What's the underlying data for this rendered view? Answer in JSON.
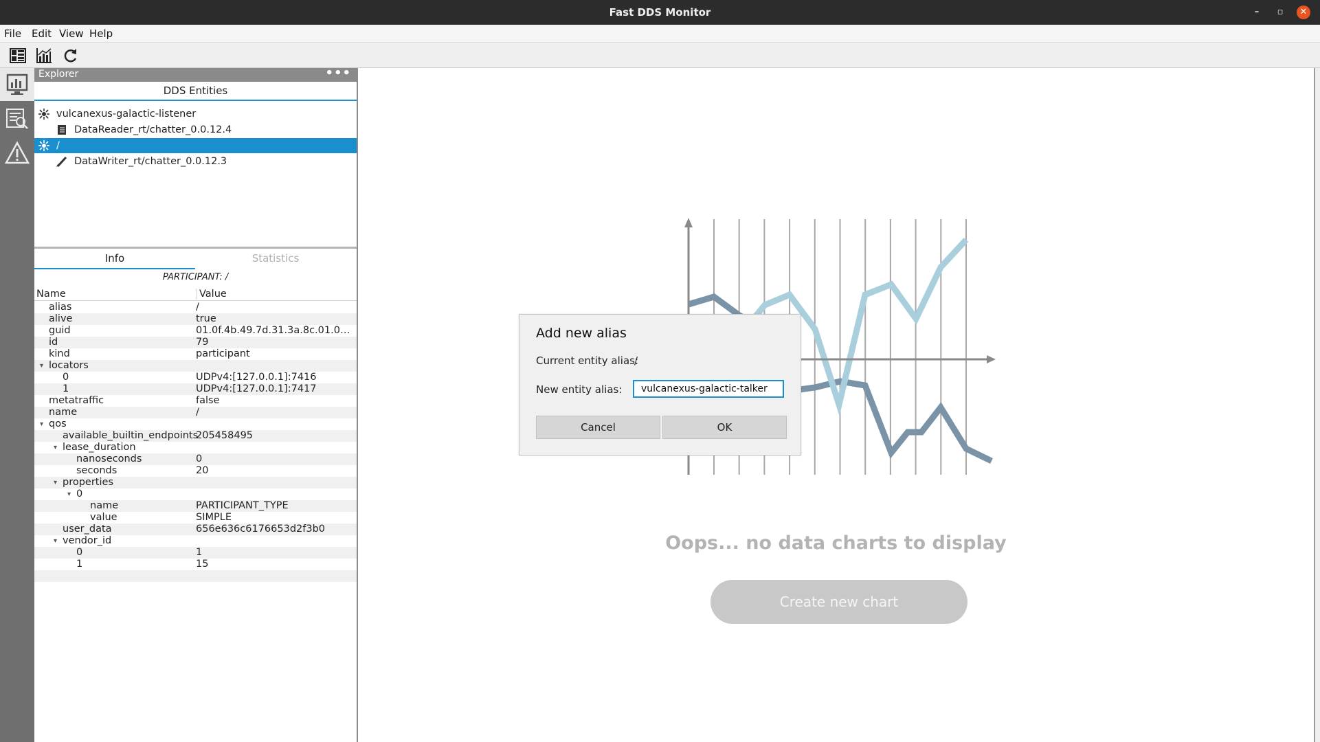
{
  "window": {
    "title": "Fast DDS Monitor",
    "controls": {
      "minimize": "–",
      "maximize": "▫",
      "close": "✕"
    }
  },
  "menubar": {
    "items": [
      "File",
      "Edit",
      "View",
      "Help"
    ]
  },
  "toolbar": {
    "buttons": [
      "dashboard-icon",
      "chart-icon",
      "refresh-icon"
    ]
  },
  "leftstrip": {
    "buttons": [
      "monitor-icon",
      "log-icon",
      "warning-icon"
    ]
  },
  "explorer": {
    "title": "Explorer",
    "menu": "•••",
    "entities_title": "DDS Entities",
    "tree": [
      {
        "icon": "participant-icon",
        "label": "vulcanexus-galactic-listener",
        "level": 0,
        "selected": false
      },
      {
        "icon": "datareader-icon",
        "label": "DataReader_rt/chatter_0.0.12.4",
        "level": 1,
        "selected": false
      },
      {
        "icon": "participant-icon",
        "label": "/",
        "level": 0,
        "selected": true
      },
      {
        "icon": "datawriter-icon",
        "label": "DataWriter_rt/chatter_0.0.12.3",
        "level": 1,
        "selected": false
      }
    ],
    "tabs": {
      "info": "Info",
      "statistics": "Statistics"
    },
    "participant_header": "PARTICIPANT: /",
    "columns": {
      "name": "Name",
      "value": "Value"
    },
    "info_rows": [
      {
        "name": "alias",
        "value": "/",
        "level": 1,
        "expander": false
      },
      {
        "name": "alive",
        "value": "true",
        "level": 1,
        "expander": false
      },
      {
        "name": "guid",
        "value": "01.0f.4b.49.7d.31.3a.8c.01.00.00...",
        "level": 1,
        "expander": false
      },
      {
        "name": "id",
        "value": "79",
        "level": 1,
        "expander": false
      },
      {
        "name": "kind",
        "value": "participant",
        "level": 1,
        "expander": false
      },
      {
        "name": "locators",
        "value": "",
        "level": 1,
        "expander": true
      },
      {
        "name": "0",
        "value": "UDPv4:[127.0.0.1]:7416",
        "level": 2,
        "expander": false
      },
      {
        "name": "1",
        "value": "UDPv4:[127.0.0.1]:7417",
        "level": 2,
        "expander": false
      },
      {
        "name": "metatraffic",
        "value": "false",
        "level": 1,
        "expander": false
      },
      {
        "name": "name",
        "value": "/",
        "level": 1,
        "expander": false
      },
      {
        "name": "qos",
        "value": "",
        "level": 1,
        "expander": true
      },
      {
        "name": "available_builtin_endpoints",
        "value": "205458495",
        "level": 2,
        "expander": false
      },
      {
        "name": "lease_duration",
        "value": "",
        "level": 2,
        "expander": true
      },
      {
        "name": "nanoseconds",
        "value": "0",
        "level": 3,
        "expander": false
      },
      {
        "name": "seconds",
        "value": "20",
        "level": 3,
        "expander": false
      },
      {
        "name": "properties",
        "value": "",
        "level": 2,
        "expander": true
      },
      {
        "name": "0",
        "value": "",
        "level": 3,
        "expander": true
      },
      {
        "name": "name",
        "value": "PARTICIPANT_TYPE",
        "level": 4,
        "expander": false
      },
      {
        "name": "value",
        "value": "SIMPLE",
        "level": 4,
        "expander": false
      },
      {
        "name": "user_data",
        "value": "656e636c6176653d2f3b0",
        "level": 2,
        "expander": false
      },
      {
        "name": "vendor_id",
        "value": "",
        "level": 2,
        "expander": true
      },
      {
        "name": "0",
        "value": "1",
        "level": 3,
        "expander": false
      },
      {
        "name": "1",
        "value": "15",
        "level": 3,
        "expander": false
      },
      {
        "name": "",
        "value": "",
        "level": 1,
        "expander": false
      }
    ]
  },
  "main": {
    "empty_message": "Oops... no data charts to display",
    "create_chart_label": "Create new chart",
    "illustration_colors": {
      "axis": "#8a8a8a",
      "grid": "#a8a8a8",
      "line_light": "#a9cfdd",
      "line_dark": "#7a93a7"
    }
  },
  "dialog": {
    "title": "Add new alias",
    "current_label": "Current entity alias:",
    "current_value": "/",
    "new_label": "New entity alias:",
    "new_value": "vulcanexus-galactic-talker",
    "cancel_label": "Cancel",
    "ok_label": "OK"
  },
  "colors": {
    "accent": "#1a8fcf",
    "close": "#e95420",
    "titlebar": "#2c2c2c"
  }
}
